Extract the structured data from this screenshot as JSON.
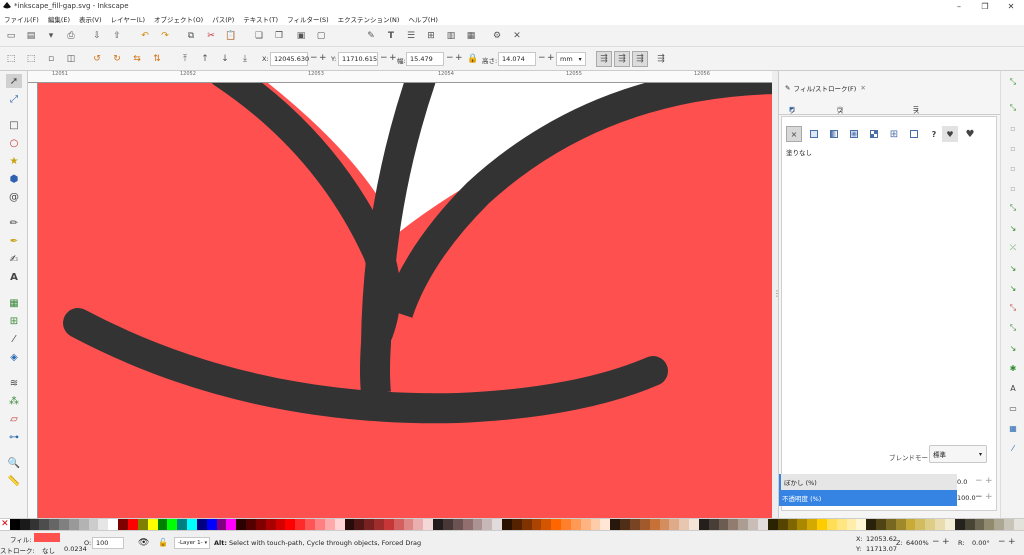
{
  "window": {
    "title": "*inkscape_fill-gap.svg - Inkscape",
    "min": "–",
    "max": "❐",
    "close": "✕"
  },
  "menu": [
    "ファイル(F)",
    "編集(E)",
    "表示(V)",
    "レイヤー(L)",
    "オブジェクト(O)",
    "パス(P)",
    "テキスト(T)",
    "フィルター(S)",
    "エクステンション(N)",
    "ヘルプ(H)"
  ],
  "controls": {
    "x_label": "X:",
    "x_value": "12045.630",
    "y_label": "Y:",
    "y_value": "11710.615",
    "w_label": "幅:",
    "w_value": "15.479",
    "h_label": "高さ:",
    "h_value": "14.074",
    "unit": "mm",
    "minus": "−",
    "plus": "+"
  },
  "ruler": {
    "ticks": [
      "12051",
      "12052",
      "12053",
      "12054",
      "12055",
      "12056"
    ]
  },
  "panel": {
    "tab_label": "フィル/ストローク(F)",
    "tab_close": "✕",
    "subtabs": [
      "フィル(F)",
      "ストロークの塗り(P)",
      "ストロークのスタイル(Y)"
    ],
    "paint_none_icon": "×",
    "paint_unknown_icon": "?",
    "status_text": "塗りなし",
    "blend_label": "ブレンドモード:",
    "blend_value": "標準",
    "blur_label": "ぼかし (%)",
    "blur_value": "0.0",
    "opacity_label": "不透明度 (%)",
    "opacity_value": "100.0"
  },
  "status": {
    "fill_label": "フィル:",
    "stroke_label": "ストローク:",
    "stroke_value": "なし",
    "stroke_width": "0.0234",
    "opacity_label": "O:",
    "opacity_value": "100",
    "layer": "-Layer 1-",
    "message_bold": "Alt:",
    "message": " Select with touch-path, Cycle through objects, Forced Drag",
    "x_label": "X:",
    "x_value": "12053.62",
    "y_label": "Y:",
    "y_value": "11713.07",
    "zoom_label": "Z:",
    "zoom_value": "6400%",
    "rot_label": "R:",
    "rot_value": "0.00°",
    "fill_color": "#ff5050"
  },
  "colors": {
    "canvas_fill": "#ff5050",
    "stroke": "#333333",
    "accent": "#3584e4"
  },
  "palette": [
    "#000000",
    "#1a1a1a",
    "#333333",
    "#4d4d4d",
    "#666666",
    "#808080",
    "#999999",
    "#b3b3b3",
    "#cccccc",
    "#e6e6e6",
    "#ffffff",
    "#800000",
    "#ff0000",
    "#808000",
    "#ffff00",
    "#008000",
    "#00ff00",
    "#008080",
    "#00ffff",
    "#000080",
    "#0000ff",
    "#800080",
    "#ff00ff",
    "#2b0000",
    "#550000",
    "#800000",
    "#aa0000",
    "#d40000",
    "#ff0000",
    "#ff2a2a",
    "#ff5555",
    "#ff8080",
    "#ffaaaa",
    "#ffd5d5",
    "#280b0b",
    "#501616",
    "#782121",
    "#a02c2c",
    "#c83737",
    "#d35f5f",
    "#de8787",
    "#e9afaf",
    "#f4d7d7",
    "#241c1c",
    "#483737",
    "#6c5353",
    "#916f6f",
    "#ac9393",
    "#c8b7b7",
    "#e3dbdb",
    "#2b1100",
    "#552200",
    "#803300",
    "#aa4400",
    "#d45500",
    "#ff6600",
    "#ff7f2a",
    "#ff9955",
    "#ffb380",
    "#ffccaa",
    "#ffe6d5",
    "#28170b",
    "#502d16",
    "#784421",
    "#a05a2c",
    "#c87137",
    "#d38d5f",
    "#deaa87",
    "#e9c6af",
    "#f4e3d7",
    "#241f1c",
    "#483e37",
    "#6c5d53",
    "#917c6f",
    "#ac9d93",
    "#c8beb7",
    "#e3dedb",
    "#2b2200",
    "#554400",
    "#806600",
    "#aa8800",
    "#d4aa00",
    "#ffcc00",
    "#ffdd55",
    "#ffe680",
    "#ffeeaa",
    "#fff6d5",
    "#28220b",
    "#504416",
    "#786721",
    "#a0892c",
    "#c8ab37",
    "#d3bc5f",
    "#decd87",
    "#e9ddaf",
    "#f4eed7",
    "#24221c",
    "#484537",
    "#6c6753",
    "#918a6f",
    "#aca793",
    "#c8c4b7",
    "#e3e2db"
  ]
}
